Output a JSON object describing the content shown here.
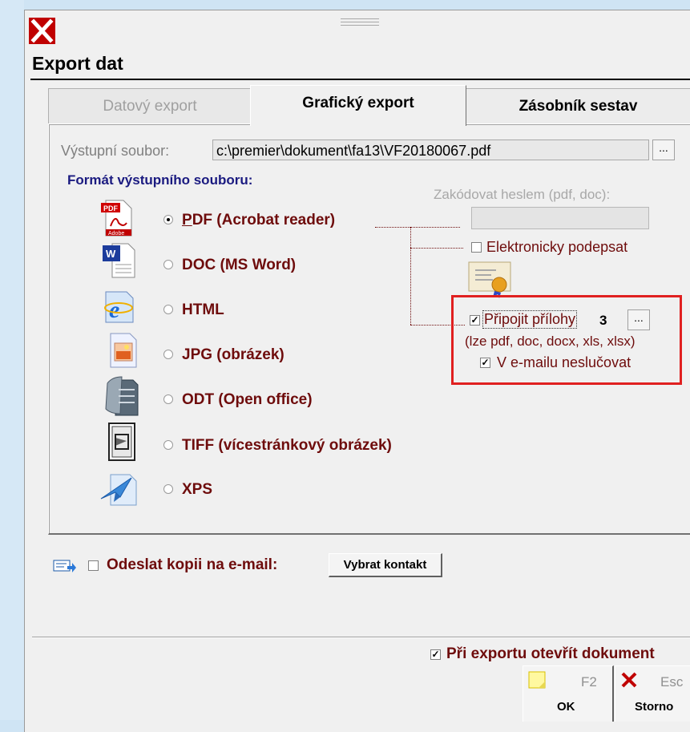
{
  "window": {
    "title": "Export dat",
    "close_icon": "close-icon"
  },
  "tabs": [
    {
      "label": "Datový export",
      "active": false
    },
    {
      "label": "Grafický export",
      "active": true
    },
    {
      "label": "Zásobník sestav",
      "active": false
    }
  ],
  "output": {
    "label": "Výstupní soubor:",
    "value": "c:\\premier\\dokument\\fa13\\VF20180067.pdf",
    "browse_label": "..."
  },
  "format": {
    "label": "Formát výstupního souboru:",
    "options": [
      {
        "label": "PDF (Acrobat reader)",
        "icon": "pdf-icon",
        "selected": true
      },
      {
        "label": "DOC (MS Word)",
        "icon": "word-icon",
        "selected": false
      },
      {
        "label": "HTML",
        "icon": "html-icon",
        "selected": false
      },
      {
        "label": "JPG (obrázek)",
        "icon": "jpg-icon",
        "selected": false
      },
      {
        "label": "ODT (Open office)",
        "icon": "odt-icon",
        "selected": false
      },
      {
        "label": "TIFF (vícestránkový obrázek)",
        "icon": "tiff-icon",
        "selected": false
      },
      {
        "label": "XPS",
        "icon": "xps-icon",
        "selected": false
      }
    ]
  },
  "pdf_options": {
    "password_label": "Zakódovat heslem (pdf, doc):",
    "password_value": "",
    "sign_label": "Elektronicky podepsat",
    "sign_checked": false,
    "attach_label": "Připojit přílohy",
    "attach_checked": true,
    "attach_count": "3",
    "attach_browse_label": "...",
    "attach_hint": "(lze pdf, doc, docx, xls, xlsx)",
    "no_merge_label": "V e-mailu neslučovat",
    "no_merge_checked": true
  },
  "email": {
    "label": "Odeslat kopii na e-mail:",
    "checked": false,
    "contact_button": "Vybrat kontakt"
  },
  "open_after": {
    "label": "Při exportu otevřít dokument",
    "checked": true
  },
  "buttons": {
    "ok": {
      "key": "F2",
      "label": "OK"
    },
    "cancel": {
      "key": "Esc",
      "label": "Storno"
    }
  },
  "colors": {
    "accent_text": "#6e0c0c",
    "format_title": "#1a1a80",
    "highlight_box": "#e02020",
    "close": "#c00000"
  }
}
